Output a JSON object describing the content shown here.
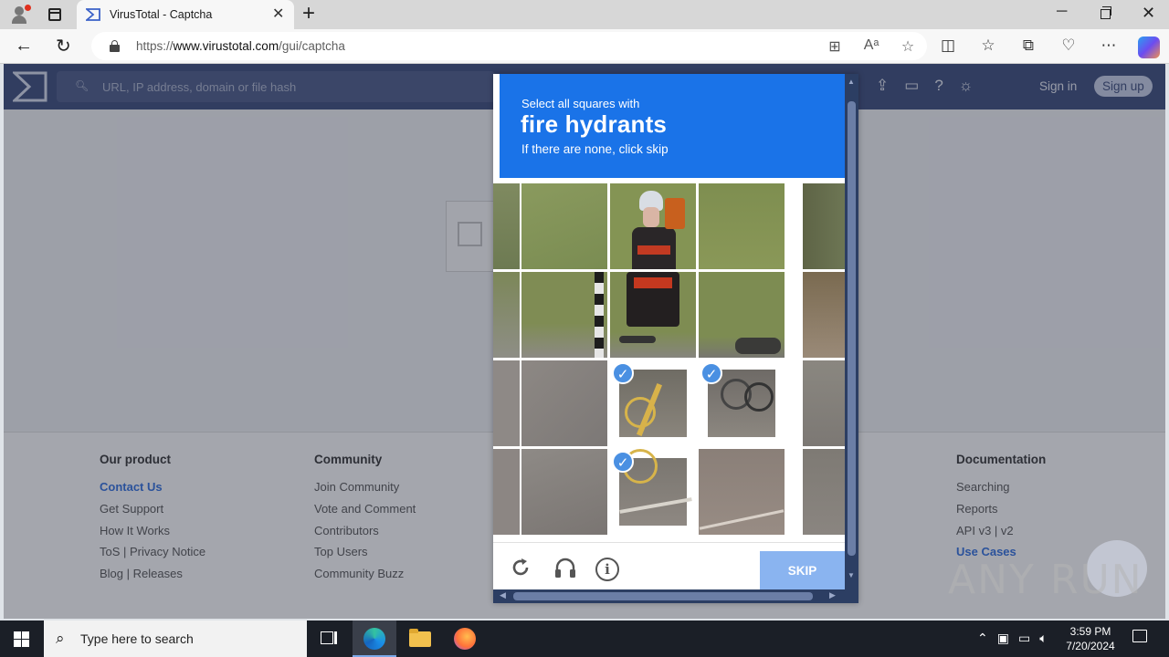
{
  "browser": {
    "tab_title": "VirusTotal - Captcha",
    "url_prefix": "https://",
    "url_domain": "www.virustotal.com",
    "url_path": "/gui/captcha",
    "accent": "#1a73e8"
  },
  "virustotal": {
    "search_placeholder": "URL, IP address, domain or file hash",
    "sign_in": "Sign in",
    "sign_up": "Sign up",
    "footer": {
      "product": {
        "heading": "Our product",
        "links": [
          "Contact Us",
          "Get Support",
          "How It Works",
          "ToS | Privacy Notice",
          "Blog | Releases"
        ]
      },
      "community": {
        "heading": "Community",
        "links": [
          "Join Community",
          "Vote and Comment",
          "Contributors",
          "Top Users",
          "Community Buzz"
        ]
      },
      "documentation": {
        "heading": "Documentation",
        "links": [
          "Searching",
          "Reports",
          "API v3 | v2",
          "Use Cases"
        ]
      }
    }
  },
  "captcha": {
    "prompt": "Select all squares with",
    "target": "fire hydrants",
    "hint": "If there are none, click skip",
    "skip_label": "SKIP",
    "info_glyph": "i",
    "check_glyph": "✓",
    "selected_tiles": [
      "row3-col2",
      "row3-col3",
      "row4-col2"
    ]
  },
  "watermark": {
    "text": "ANY RUN"
  },
  "taskbar": {
    "search_placeholder": "Type here to search",
    "time": "3:59 PM",
    "date": "7/20/2024"
  }
}
